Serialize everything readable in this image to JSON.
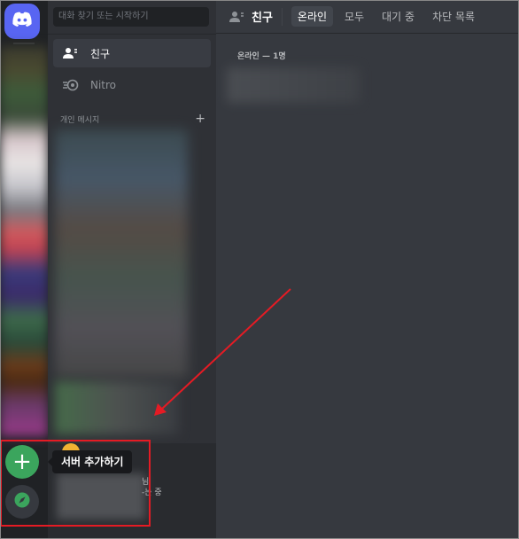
{
  "search": {
    "placeholder": "대화 찾기 또는 시작하기"
  },
  "sidebar": {
    "friends_label": "친구",
    "nitro_label": "Nitro",
    "dm_header": "개인 메시지",
    "dm_add": "+"
  },
  "user_panel": {
    "status_fragment": "님\n-는 중"
  },
  "tooltip": {
    "text": "서버 추가하기"
  },
  "server_rail": {
    "add_label": "+"
  },
  "header": {
    "title": "친구",
    "tabs": [
      {
        "label": "온라인",
        "active": true
      },
      {
        "label": "모두",
        "active": false
      },
      {
        "label": "대기 중",
        "active": false
      },
      {
        "label": "차단 목록",
        "active": false
      }
    ]
  },
  "main": {
    "online_header": "온라인 — 1명"
  },
  "colors": {
    "brand": "#5865f2",
    "add_server": "#3ba55d",
    "annotation": "#e51b24"
  },
  "icons": [
    "discord-logo-icon",
    "plus-icon",
    "compass-icon",
    "friends-wave-icon",
    "nitro-icon"
  ]
}
